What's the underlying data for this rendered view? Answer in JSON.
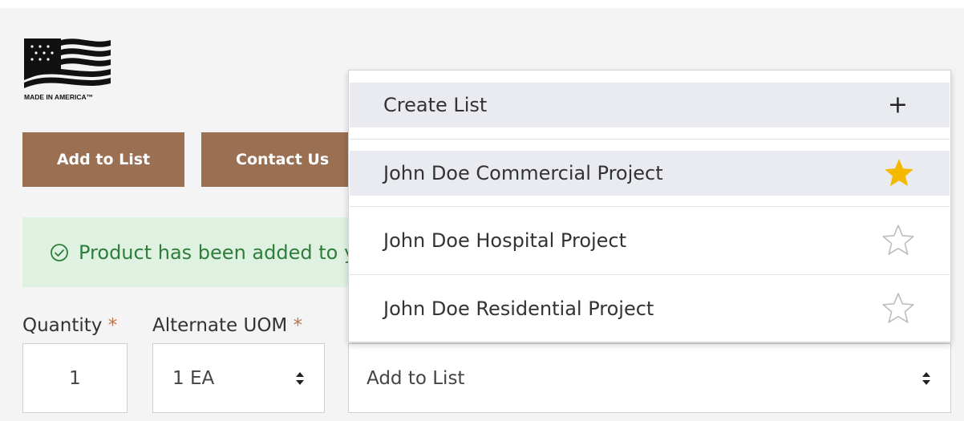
{
  "logo": {
    "text": "MADE IN AMERICA™"
  },
  "buttons": {
    "add_to_list": "Add to List",
    "contact_us": "Contact Us"
  },
  "alert": {
    "message": "Product has been added to your list.",
    "icon": "check-circle-icon",
    "color": "#2e7d3a"
  },
  "quantity": {
    "label": "Quantity",
    "required_mark": "*",
    "value": "1"
  },
  "uom": {
    "label": "Alternate UOM",
    "required_mark": "*",
    "selected": "1 EA"
  },
  "list_select": {
    "selected": "Add to List"
  },
  "dropdown": {
    "create_label": "Create List",
    "create_icon": "plus-icon",
    "items": [
      {
        "label": "John Doe Commercial Project",
        "favorite": true,
        "icon": "star-filled-icon"
      },
      {
        "label": "John Doe Hospital Project",
        "favorite": false,
        "icon": "star-outline-icon"
      },
      {
        "label": "John Doe Residential Project",
        "favorite": false,
        "icon": "star-outline-icon"
      }
    ]
  },
  "colors": {
    "brand_button": "#9a6f52",
    "alert_bg": "#dff2e1",
    "required": "#c0714a",
    "star_filled": "#f5b800",
    "highlight_row": "#e9ebf0"
  }
}
